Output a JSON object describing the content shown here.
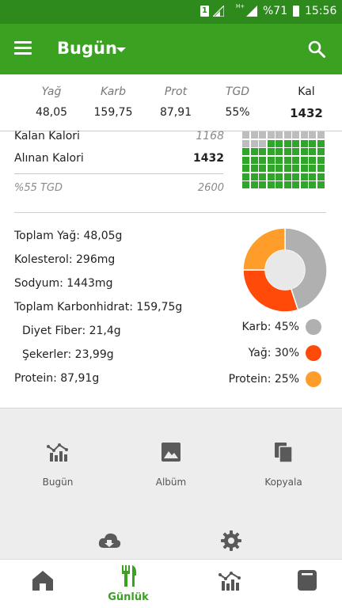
{
  "status_bar": {
    "sim_slot": "1",
    "network_type": "H+",
    "battery_percent": "%71",
    "time": "15:56"
  },
  "app_bar": {
    "title": "Bugün"
  },
  "macros": [
    {
      "label": "Yağ",
      "value": "48,05"
    },
    {
      "label": "Karb",
      "value": "159,75"
    },
    {
      "label": "Prot",
      "value": "87,91"
    },
    {
      "label": "TGD",
      "value": "55%"
    },
    {
      "label": "Kal",
      "value": "1432"
    }
  ],
  "calorie_summary": {
    "remaining": {
      "label": "Kalan Kalori",
      "value": "1168"
    },
    "consumed": {
      "label": "Alınan Kalori",
      "value": "1432"
    },
    "target": {
      "label": "%55 TGD",
      "value": "2600"
    }
  },
  "waffle": {
    "filled_fraction": 0.55,
    "colors": {
      "filled": "#2fa52a",
      "empty": "#bdbdbd"
    }
  },
  "nutrients": [
    "Toplam Yağ: 48,05g",
    "Kolesterol: 296mg",
    "Sodyum: 1443mg",
    "Toplam Karbonhidrat: 159,75g",
    "Diyet Fiber: 21,4g",
    "Şekerler: 23,99g",
    "Protein: 87,91g"
  ],
  "macro_split": [
    {
      "label": "Karb: 45%",
      "percent": 45,
      "color": "#b0b0b0"
    },
    {
      "label": "Yağ: 30%",
      "percent": 30,
      "color": "#ff4a0a"
    },
    {
      "label": "Protein: 25%",
      "percent": 25,
      "color": "#ff9d2a"
    }
  ],
  "actions": [
    {
      "label": "Bugün",
      "icon": "chart-icon"
    },
    {
      "label": "Albüm",
      "icon": "image-icon"
    },
    {
      "label": "Kopyala",
      "icon": "copy-icon"
    }
  ],
  "secondary_actions": [
    {
      "icon": "cloud-download-icon"
    },
    {
      "icon": "gear-icon"
    }
  ],
  "bottom_nav": {
    "active_label": "Günlük",
    "items": [
      {
        "icon": "home-icon"
      },
      {
        "icon": "cutlery-icon",
        "label": "Günlük"
      },
      {
        "icon": "chart-icon"
      },
      {
        "icon": "notebook-icon"
      }
    ]
  },
  "accent_color": "#3aa121"
}
